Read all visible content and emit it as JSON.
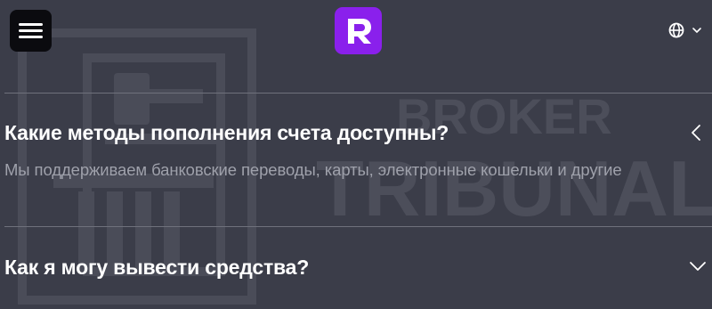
{
  "header": {
    "menu_icon": "hamburger-menu-icon",
    "logo_icon": "brand-logo-r",
    "language_icon": "globe-icon",
    "dropdown_icon": "chevron-down-icon"
  },
  "watermark": {
    "line1": "BROKER",
    "line2": "TRIBUNAL"
  },
  "faq": {
    "items": [
      {
        "question": "Какие методы пополнения счета доступны?",
        "answer": "Мы поддерживаем банковские переводы, карты, электронные кошельки и другие",
        "state": "expanded",
        "icon": "chevron-left-icon"
      },
      {
        "question": "Как я могу вывести средства?",
        "state": "collapsed",
        "icon": "chevron-down-icon"
      }
    ]
  },
  "colors": {
    "background": "#3b3d49",
    "accent": "#8a20ec",
    "answer_text": "#9fa1ab",
    "divider": "#6f717c"
  }
}
